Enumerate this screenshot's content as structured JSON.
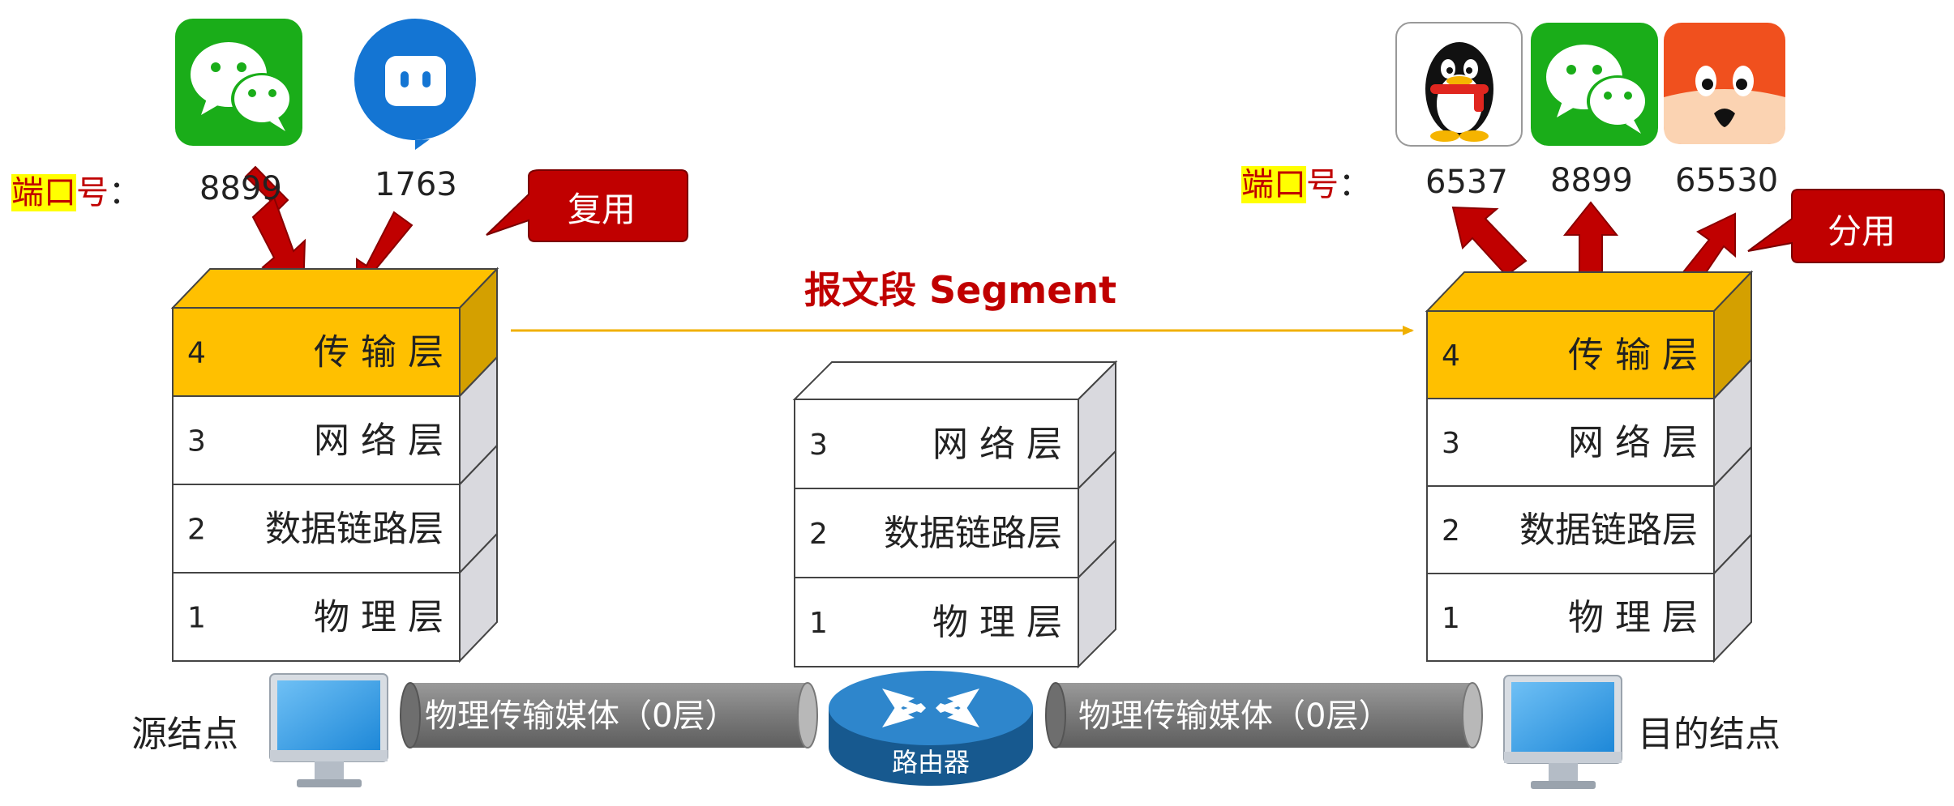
{
  "segment_label": "报文段 Segment",
  "left": {
    "port_label": {
      "highlight": "端口",
      "rest": "号",
      "colon": "："
    },
    "ports": [
      "8899",
      "1763"
    ],
    "callout": "复用",
    "node_label": "源结点",
    "stack": [
      {
        "num": "4",
        "name": "传 输 层"
      },
      {
        "num": "3",
        "name": "网 络 层"
      },
      {
        "num": "2",
        "name": "数据链路层"
      },
      {
        "num": "1",
        "name": "物 理 层"
      }
    ]
  },
  "middle": {
    "stack": [
      {
        "num": "3",
        "name": "网 络 层"
      },
      {
        "num": "2",
        "name": "数据链路层"
      },
      {
        "num": "1",
        "name": "物 理 层"
      }
    ],
    "router_label": "路由器"
  },
  "right": {
    "port_label": {
      "highlight": "端口",
      "rest": "号",
      "colon": "："
    },
    "ports": [
      "6537",
      "8899",
      "65530"
    ],
    "callout": "分用",
    "node_label": "目的结点",
    "stack": [
      {
        "num": "4",
        "name": "传 输 层"
      },
      {
        "num": "3",
        "name": "网 络 层"
      },
      {
        "num": "2",
        "name": "数据链路层"
      },
      {
        "num": "1",
        "name": "物 理 层"
      }
    ]
  },
  "media": [
    "物理传输媒体（0层）",
    "物理传输媒体（0层）"
  ],
  "colors": {
    "transport": "#ffc000",
    "transport_side": "#d4a000",
    "layer_side": "#d9d9de",
    "arrow_red": "#c00000",
    "callout_red": "#c00000",
    "cylinder": "#808080",
    "router": "#1f6fb2",
    "segment_line": "#f0b000",
    "wechat_green": "#1aad19",
    "app_blue": "#1475d3",
    "fox_orange": "#f0501e"
  },
  "icons": [
    "wechat-icon",
    "blue-chat-icon",
    "qq-penguin-icon",
    "wechat-icon",
    "fox-app-icon",
    "monitor-icon",
    "router-icon"
  ]
}
